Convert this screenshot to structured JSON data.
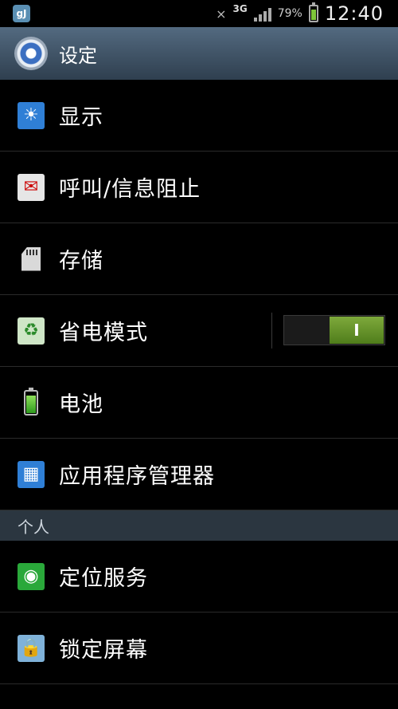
{
  "status_bar": {
    "app_icon_label": "gJ",
    "network": "3G",
    "battery_percent": "79%",
    "battery_level": 0.79,
    "clock": "12:40"
  },
  "header": {
    "title": "设定"
  },
  "items": [
    {
      "label": "显示",
      "icon": "display-icon"
    },
    {
      "label": "呼叫/信息阻止",
      "icon": "call-block-icon"
    },
    {
      "label": "存储",
      "icon": "storage-icon"
    },
    {
      "label": "省电模式",
      "icon": "power-saving-icon",
      "toggle_label": "I",
      "toggle_on": true
    },
    {
      "label": "电池",
      "icon": "battery-icon"
    },
    {
      "label": "应用程序管理器",
      "icon": "app-manager-icon"
    }
  ],
  "section_personal": {
    "title": "个人"
  },
  "personal_items": [
    {
      "label": "定位服务",
      "icon": "location-icon"
    },
    {
      "label": "锁定屏幕",
      "icon": "lock-screen-icon"
    }
  ]
}
